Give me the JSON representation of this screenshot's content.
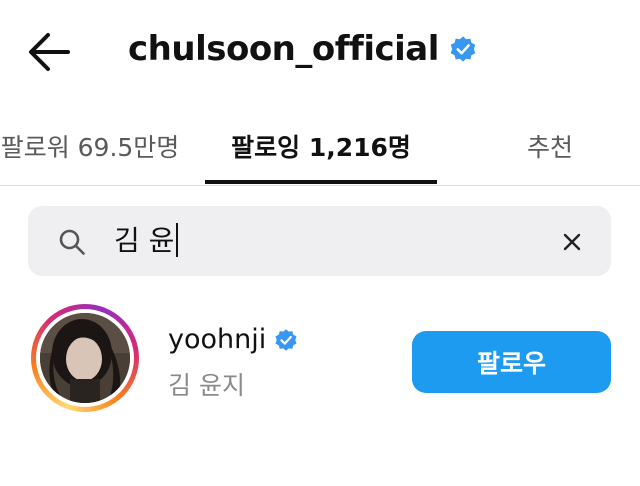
{
  "header": {
    "title": "chulsoon_official",
    "back_icon": "arrow-left-icon",
    "verified_icon": "verified-badge-icon"
  },
  "tabs": [
    {
      "label": "팔로워 69.5만명",
      "active": false
    },
    {
      "label": "팔로잉 1,216명",
      "active": true
    },
    {
      "label": "추천",
      "active": false
    }
  ],
  "search": {
    "value": "김 윤",
    "search_icon": "search-icon",
    "clear_icon": "close-icon"
  },
  "results": [
    {
      "username": "yoohnji",
      "full_name": "김 윤지",
      "verified": true,
      "button_label": "팔로우"
    }
  ],
  "colors": {
    "accent": "#1d9bf0",
    "verified": "#3897f0",
    "search_bg": "#efeff1",
    "secondary_text": "#8a8a8a"
  }
}
